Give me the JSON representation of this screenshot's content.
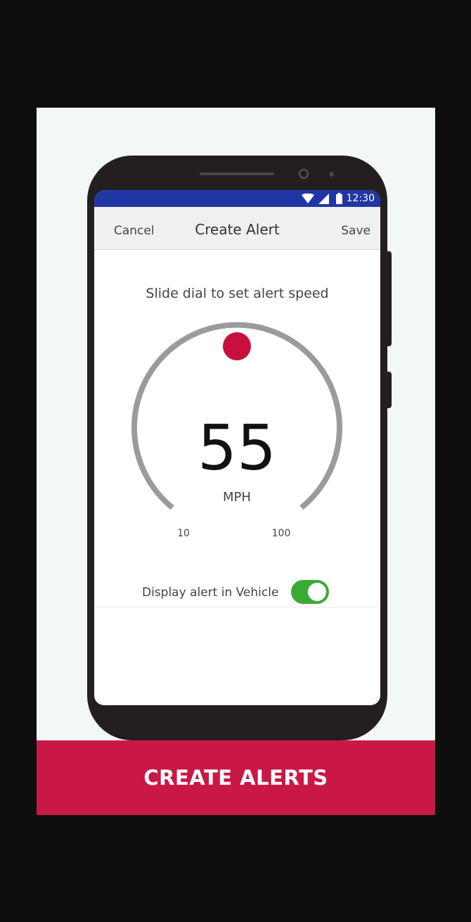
{
  "status_bar": {
    "time": "12:30",
    "icons": [
      "wifi-icon",
      "signal-icon",
      "battery-icon"
    ],
    "color": "#2136a5"
  },
  "app_bar": {
    "cancel_label": "Cancel",
    "title": "Create Alert",
    "save_label": "Save"
  },
  "alert": {
    "instruction": "Slide dial to set alert speed",
    "speed_value": "55",
    "unit": "MPH",
    "min_label": "10",
    "max_label": "100",
    "min": 10,
    "max": 100,
    "handle_color": "#c8103e",
    "track_color": "#9b9b9b"
  },
  "toggle": {
    "label": "Display alert in Vehicle",
    "on": true,
    "color": "#3aaa35"
  },
  "banner": {
    "text": "CREATE ALERTS",
    "color": "#c91845"
  }
}
